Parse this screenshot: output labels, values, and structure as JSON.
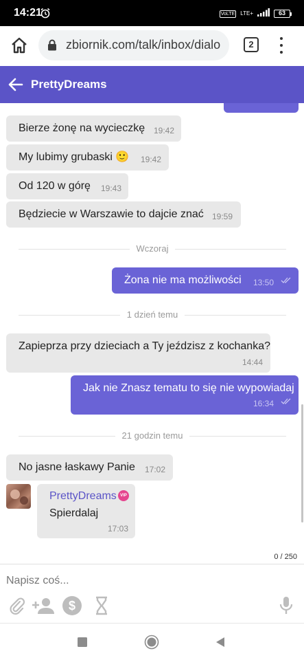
{
  "status_bar": {
    "time": "14:21",
    "network": "LTE+",
    "volte": "VoLTE",
    "battery": "63"
  },
  "browser": {
    "url": "zbiornik.com/talk/inbox/dialo",
    "tab_count": "2"
  },
  "chat": {
    "title": "PrettyDreams"
  },
  "messages": [
    {
      "dir": "in",
      "text": "Bierze żonę na wycieczkę",
      "time": "19:42"
    },
    {
      "dir": "in",
      "text": "My lubimy grubaski 🙂",
      "time": "19:42"
    },
    {
      "dir": "in",
      "text": "Od 120 w górę",
      "time": "19:43"
    },
    {
      "dir": "in",
      "text": "Będziecie w Warszawie to dajcie znać",
      "time": "19:59"
    },
    {
      "dir": "out",
      "text": "Żona nie ma możliwości",
      "time": "13:50"
    },
    {
      "dir": "in",
      "text": "Zapieprza przy dzieciach a Ty jeździsz z kochanka?",
      "time": "14:44"
    },
    {
      "dir": "out",
      "text": "Jak nie Znasz tematu to się nie wypowiadaj",
      "time": "16:34"
    },
    {
      "dir": "in",
      "text": "No jasne łaskawy Panie",
      "time": "17:02"
    },
    {
      "dir": "in",
      "sender": "PrettyDreams",
      "badge": "VIP",
      "text": "Spierdalaj",
      "time": "17:03"
    }
  ],
  "dividers": [
    "Wczoraj",
    "1 dzień temu",
    "21 godzin temu"
  ],
  "composer": {
    "placeholder": "Napisz coś...",
    "counter": "0 / 250"
  },
  "colors": {
    "accent": "#5b54c7",
    "outgoing_bubble": "#6a63d6",
    "incoming_bubble": "#e8e8e8",
    "vip": "#e5468f"
  },
  "icons": [
    "alarm-icon",
    "home-icon",
    "lock-icon",
    "more-vert-icon",
    "back-arrow-icon",
    "double-check-icon",
    "attachment-icon",
    "add-person-icon",
    "dollar-icon",
    "hourglass-icon",
    "microphone-icon",
    "recents-icon",
    "home-circle-icon",
    "back-triangle-icon"
  ]
}
